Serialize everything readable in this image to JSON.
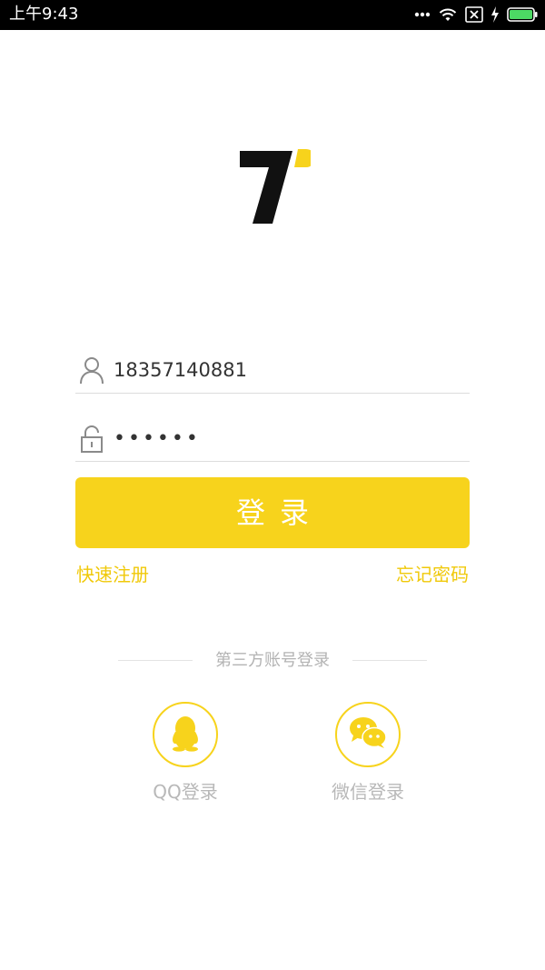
{
  "status_bar": {
    "time": "上午9:43"
  },
  "login": {
    "phone_value": "18357140881",
    "password_value": "••••••",
    "submit_label": "登录",
    "register_link": "快速注册",
    "forgot_link": "忘记密码"
  },
  "third_party": {
    "divider_text": "第三方账号登录",
    "qq_label": "QQ登录",
    "wechat_label": "微信登录"
  },
  "colors": {
    "accent": "#f7d31c",
    "link": "#f0c90a",
    "muted_text": "#b8b8b8"
  },
  "icons": {
    "user": "user-icon",
    "lock": "lock-open-icon",
    "qq": "qq-penguin-icon",
    "wechat": "wechat-icon"
  }
}
